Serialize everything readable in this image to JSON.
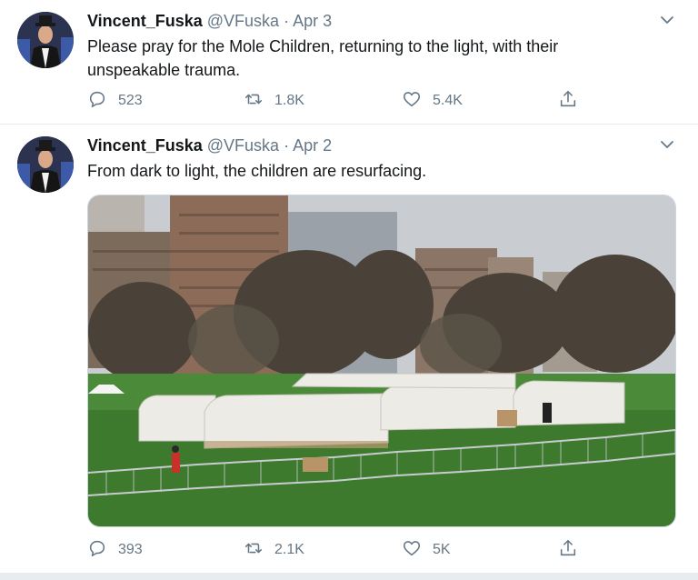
{
  "tweets": [
    {
      "name": "Vincent_Fuska",
      "handle": "@VFuska",
      "separator": "·",
      "date": "Apr 3",
      "text": "Please pray for the Mole Children, returning to the light, with their unspeakable trauma.",
      "replies": "523",
      "retweets": "1.8K",
      "likes": "5.4K"
    },
    {
      "name": "Vincent_Fuska",
      "handle": "@VFuska",
      "separator": "·",
      "date": "Apr 2",
      "text": "From dark to light, the children are resurfacing.",
      "replies": "393",
      "retweets": "2.1K",
      "likes": "5K",
      "photo": {
        "type": "image",
        "subject": "white tents in a park with city buildings"
      }
    }
  ],
  "icons": {
    "reply": "reply-icon",
    "retweet": "retweet-icon",
    "like": "heart-icon",
    "share": "share-icon",
    "menu": "chevron-down-icon"
  },
  "colors": {
    "text": "#14171a",
    "secondary": "#657786",
    "divider": "#e6ecf0"
  }
}
